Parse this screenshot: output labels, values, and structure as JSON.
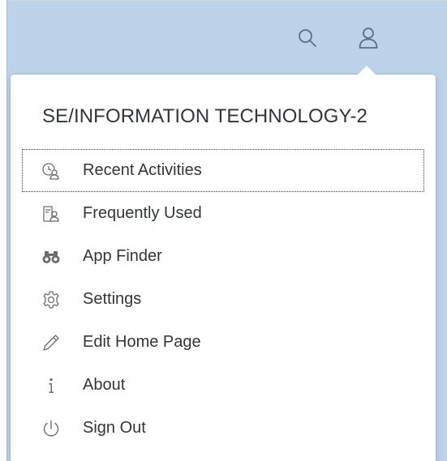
{
  "header": {
    "search_icon": "search-icon",
    "user_icon": "person-icon",
    "bar_color": "#bcd3ea"
  },
  "user_menu": {
    "title": "SE/INFORMATION TECHNOLOGY-2",
    "focused_item": "Recent Activities",
    "items": [
      {
        "label": "Recent Activities",
        "icon": "recent-activities-icon"
      },
      {
        "label": "Frequently Used",
        "icon": "frequently-used-icon"
      },
      {
        "label": "App Finder",
        "icon": "binoculars-icon"
      },
      {
        "label": "Settings",
        "icon": "gear-icon"
      },
      {
        "label": "Edit Home Page",
        "icon": "pencil-icon"
      },
      {
        "label": "About",
        "icon": "info-icon"
      },
      {
        "label": "Sign Out",
        "icon": "power-icon"
      }
    ]
  }
}
